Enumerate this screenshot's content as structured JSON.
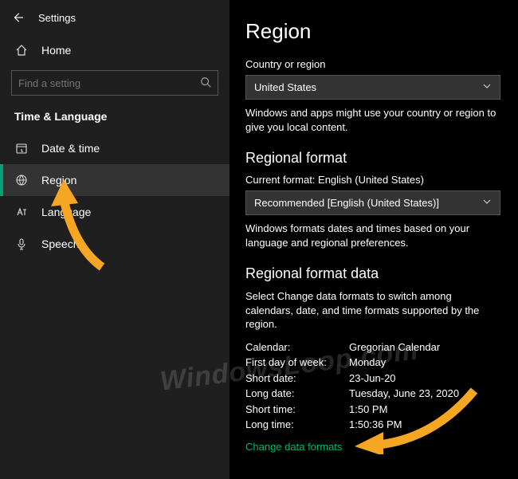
{
  "app": {
    "title": "Settings"
  },
  "home": {
    "label": "Home"
  },
  "search": {
    "placeholder": "Find a setting"
  },
  "section": {
    "title": "Time & Language"
  },
  "nav": {
    "items": [
      {
        "label": "Date & time"
      },
      {
        "label": "Region"
      },
      {
        "label": "Language"
      },
      {
        "label": "Speech"
      }
    ]
  },
  "page": {
    "title": "Region",
    "country_label": "Country or region",
    "country_value": "United States",
    "country_help": "Windows and apps might use your country or region to give you local content.",
    "format_heading": "Regional format",
    "format_label": "Current format: English (United States)",
    "format_value": "Recommended [English (United States)]",
    "format_help": "Windows formats dates and times based on your language and regional preferences.",
    "data_heading": "Regional format data",
    "data_help": "Select Change data formats to switch among calendars, date, and time formats supported by the region.",
    "rows": [
      {
        "k": "Calendar:",
        "v": "Gregorian Calendar"
      },
      {
        "k": "First day of week:",
        "v": "Monday"
      },
      {
        "k": "Short date:",
        "v": "23-Jun-20"
      },
      {
        "k": "Long date:",
        "v": "Tuesday, June 23, 2020"
      },
      {
        "k": "Short time:",
        "v": "1:50 PM"
      },
      {
        "k": "Long time:",
        "v": "1:50:36 PM"
      }
    ],
    "change_link": "Change data formats"
  },
  "watermark": "WindowsLoop.com"
}
